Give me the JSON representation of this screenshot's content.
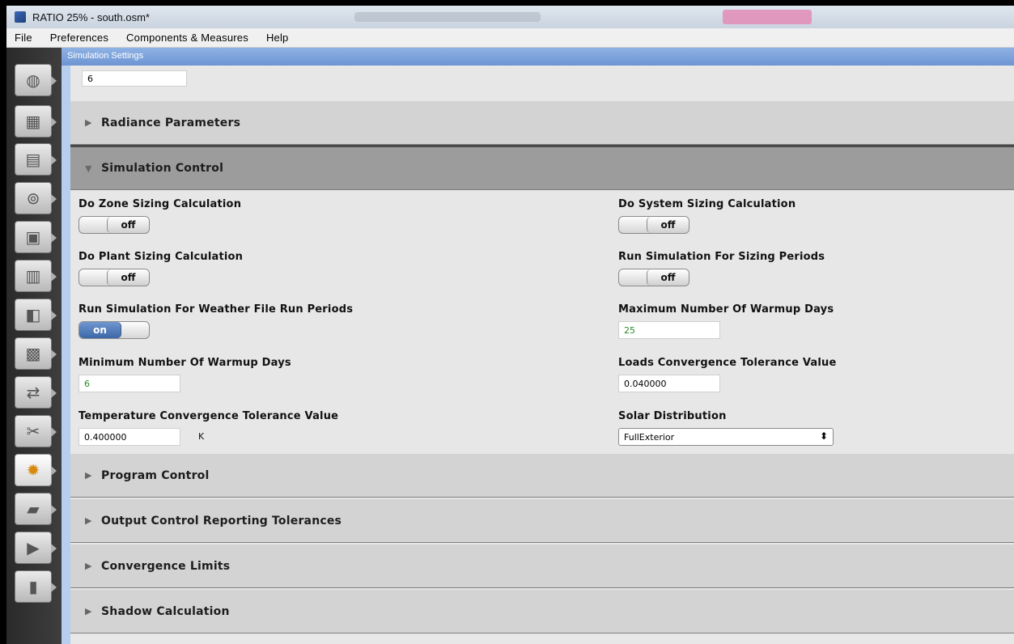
{
  "window": {
    "title": "RATIO 25% - south.osm*"
  },
  "menu": [
    "File",
    "Preferences",
    "Components & Measures",
    "Help"
  ],
  "sidebar_tools": [
    {
      "name": "site-tool-icon",
      "glyph": "◍"
    },
    {
      "name": "schedules-tool-icon",
      "glyph": "▦"
    },
    {
      "name": "constructions-tool-icon",
      "glyph": "▤"
    },
    {
      "name": "loads-tool-icon",
      "glyph": "⊚"
    },
    {
      "name": "space-types-tool-icon",
      "glyph": "▣"
    },
    {
      "name": "facility-tool-icon",
      "glyph": "▥"
    },
    {
      "name": "spaces-tool-icon",
      "glyph": "◧"
    },
    {
      "name": "thermal-zones-tool-icon",
      "glyph": "▩"
    },
    {
      "name": "hvac-systems-tool-icon",
      "glyph": "⇄"
    },
    {
      "name": "variables-tool-icon",
      "glyph": "✂"
    },
    {
      "name": "simulation-settings-tool-icon",
      "glyph": "✹"
    },
    {
      "name": "scripts-tool-icon",
      "glyph": "▰"
    },
    {
      "name": "run-simulation-tool-icon",
      "glyph": "▶"
    },
    {
      "name": "results-summary-tool-icon",
      "glyph": "▮"
    }
  ],
  "panel": {
    "title": "Simulation Settings",
    "top_value": "6"
  },
  "sections": {
    "radiance": "Radiance Parameters",
    "simulation_control": "Simulation Control",
    "program_control": "Program Control",
    "output_control": "Output Control Reporting Tolerances",
    "convergence": "Convergence Limits",
    "shadow": "Shadow Calculation"
  },
  "simulation_control": {
    "do_zone_sizing": {
      "label": "Do Zone Sizing Calculation",
      "state": "off"
    },
    "do_system_sizing": {
      "label": "Do System Sizing Calculation",
      "state": "off"
    },
    "do_plant_sizing": {
      "label": "Do Plant Sizing Calculation",
      "state": "off"
    },
    "run_sizing_periods": {
      "label": "Run Simulation For Sizing Periods",
      "state": "off"
    },
    "run_weather_periods": {
      "label": "Run Simulation For Weather File Run Periods",
      "state": "on"
    },
    "max_warmup": {
      "label": "Maximum Number Of Warmup Days",
      "value": "25"
    },
    "min_warmup": {
      "label": "Minimum Number Of Warmup Days",
      "value": "6"
    },
    "loads_tol": {
      "label": "Loads Convergence Tolerance Value",
      "value": "0.040000"
    },
    "temp_tol": {
      "label": "Temperature Convergence Tolerance Value",
      "value": "0.400000",
      "unit": "K"
    },
    "solar_dist": {
      "label": "Solar Distribution",
      "value": "FullExterior"
    }
  },
  "colors": {
    "accent_blue": "#6d95d3",
    "on_toggle": "#3c67a8",
    "default_value_green": "#2a8b2a"
  }
}
